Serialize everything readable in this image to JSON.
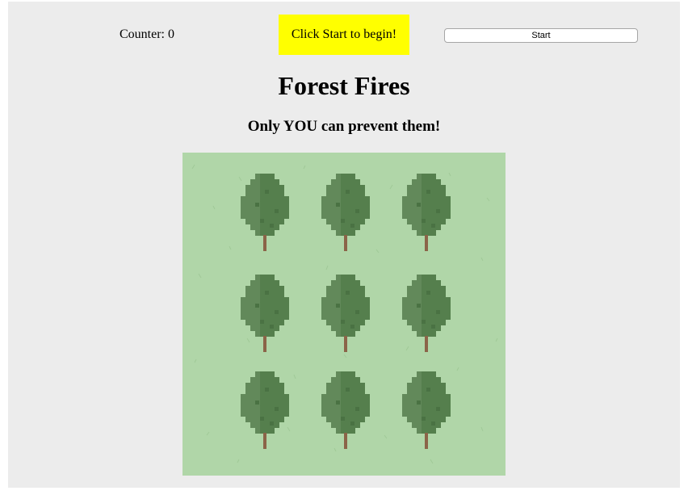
{
  "counter": {
    "text": "Counter: 0"
  },
  "message": {
    "text": "Click Start to begin!"
  },
  "start_button": {
    "label": "Start"
  },
  "title": "Forest Fires",
  "subtitle": "Only YOU can prevent them!",
  "board": {
    "rows": 3,
    "cols": 3,
    "cells": [
      "tree",
      "tree",
      "tree",
      "tree",
      "tree",
      "tree",
      "tree",
      "tree",
      "tree"
    ]
  },
  "colors": {
    "panel": "#ececec",
    "message_bg": "#ffff00",
    "grass": "#b0d6a8",
    "tree_dark": "#557f4d",
    "tree_light": "#62895a",
    "trunk": "#8b6448"
  }
}
